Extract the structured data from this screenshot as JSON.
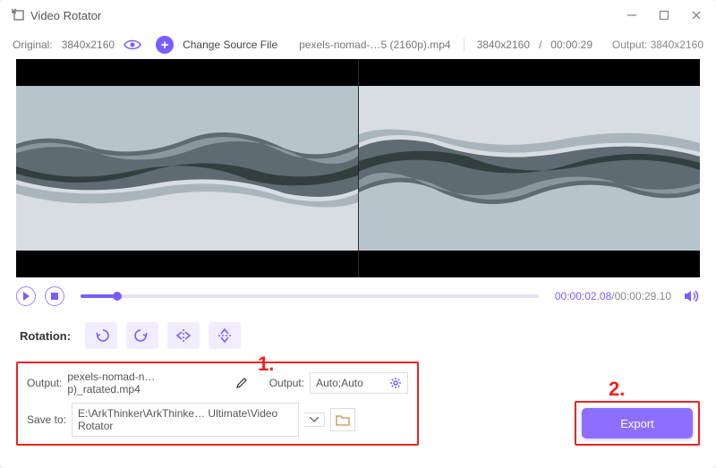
{
  "window": {
    "title": "Video Rotator"
  },
  "infobar": {
    "original_label": "Original:",
    "original_res": "3840x2160",
    "change_source": "Change Source File",
    "filename": "pexels-nomad-…5 (2160p).mp4",
    "file_res": "3840x2160",
    "file_dur": "00:00:29",
    "output_label": "Output:",
    "output_res": "3840x2160"
  },
  "playback": {
    "current_time": "00:00:02.08",
    "total_time": "00:00:29.10"
  },
  "rotation": {
    "label": "Rotation:"
  },
  "markers": {
    "one": "1.",
    "two": "2."
  },
  "output": {
    "output_label": "Output:",
    "output_filename": "pexels-nomad-n…p)_ratated.mp4",
    "output_label2": "Output:",
    "output_format": "Auto;Auto",
    "save_to_label": "Save to:",
    "save_to_path": "E:\\ArkThinker\\ArkThinke… Ultimate\\Video Rotator"
  },
  "export": {
    "label": "Export"
  }
}
